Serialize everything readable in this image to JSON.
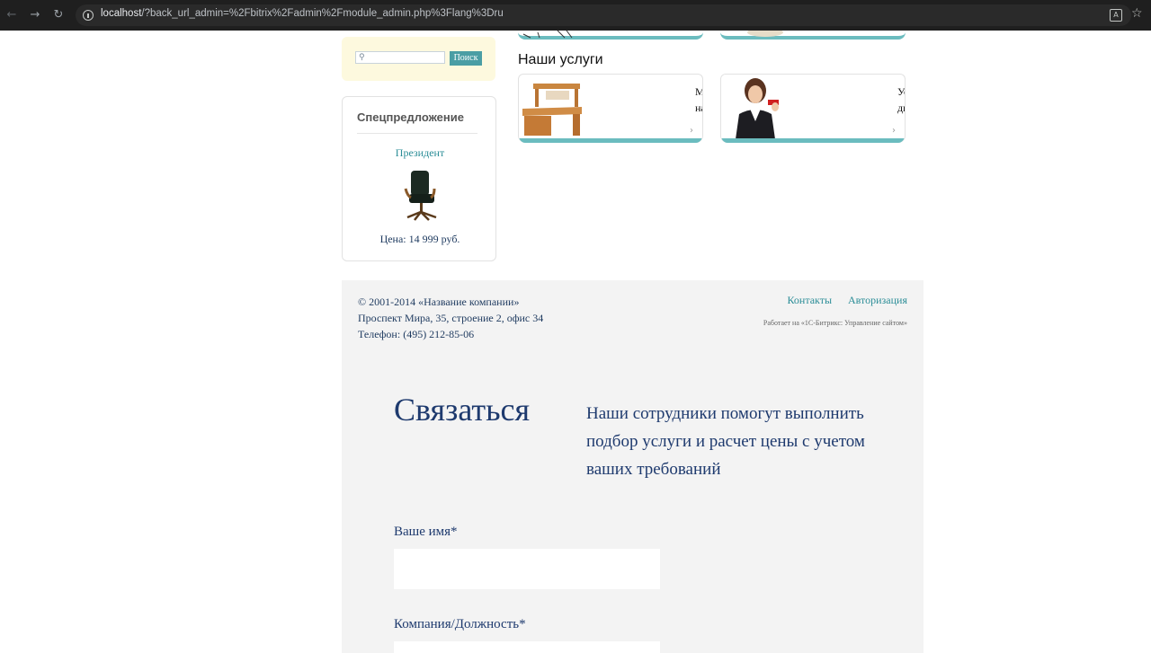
{
  "browser": {
    "url_host": "localhost",
    "url_rest": "/?back_url_admin=%2Fbitrix%2Fadmin%2Fmodule_admin.php%3Flang%3Dru",
    "back_icon": "arrow-left-icon",
    "forward_icon": "arrow-right-icon",
    "reload_icon": "reload-icon"
  },
  "search": {
    "button_label": "Поиск",
    "icon": "search-icon"
  },
  "special_offer": {
    "title": "Спецпредложение",
    "product_name": "Президент",
    "price": "Цена: 14 999 руб."
  },
  "services": {
    "title": "Наши услуги",
    "cards": [
      {
        "text_line1": "М",
        "text_line2": "на"
      },
      {
        "text_line1": "Ус",
        "text_line2": "ди"
      }
    ],
    "arrow": "›"
  },
  "footer": {
    "copyright": "© 2001-2014 «Название компании»",
    "address": "Проспект Мира, 35, строение 2, офис 34",
    "phone": "Телефон: (495) 212-85-06",
    "link_contacts": "Контакты",
    "link_auth": "Авторизация",
    "powered": "Работает на «1С-Битрикс: Управление сайтом»"
  },
  "contact_form": {
    "title": "Связаться",
    "description": "Наши сотрудники помогут выполнить подбор услуги и расчет цены с учетом ваших требований",
    "label_name": "Ваше имя*",
    "label_company": "Компания/Должность*"
  },
  "colors": {
    "accent": "#6bbcbf",
    "link": "#2b8d97",
    "heading": "#1e3a6e"
  }
}
